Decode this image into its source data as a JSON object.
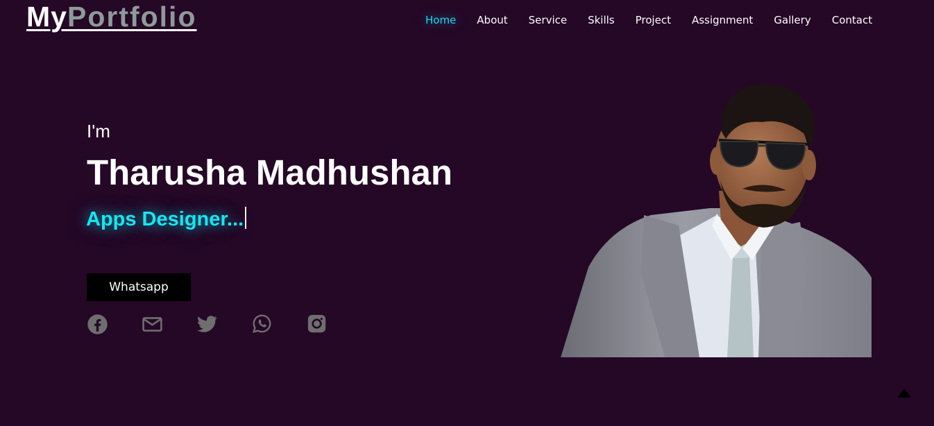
{
  "brand": {
    "part1": "My",
    "part2": "Portfolio"
  },
  "nav": {
    "items": [
      {
        "label": "Home",
        "active": true
      },
      {
        "label": "About"
      },
      {
        "label": "Service"
      },
      {
        "label": "Skills"
      },
      {
        "label": "Project"
      },
      {
        "label": "Assignment"
      },
      {
        "label": "Gallery"
      },
      {
        "label": "Contact"
      }
    ]
  },
  "hero": {
    "intro": "I'm",
    "name": "Tharusha Madhushan",
    "role": "Apps Designer...",
    "button_label": "Whatsapp"
  },
  "socials": [
    "facebook-icon",
    "email-icon",
    "twitter-icon",
    "whatsapp-icon",
    "instagram-icon"
  ],
  "colors": {
    "background": "#250726",
    "accent": "#12e8f2",
    "nav_active": "#19d8f0",
    "icon_gray": "#6e6e6e",
    "logo_gray": "#8e9a9a"
  }
}
